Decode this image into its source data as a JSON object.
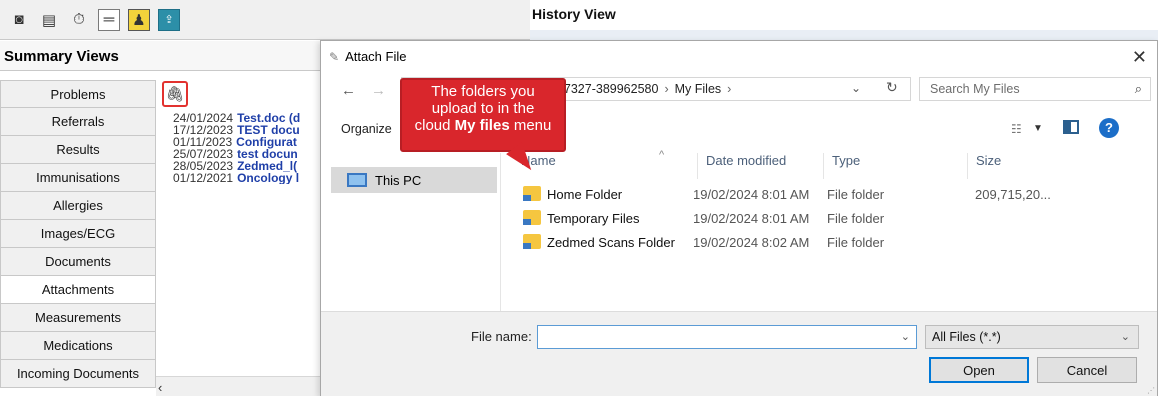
{
  "app": {
    "toolbar_icons": [
      "camera-icon",
      "clipboard-icon",
      "timer-icon",
      "ruler-icon",
      "person-icon",
      "upload-icon"
    ],
    "summary_title": "Summary Views",
    "history_title": "History View",
    "sidebar": {
      "items": [
        {
          "label": "Problems"
        },
        {
          "label": "Referrals"
        },
        {
          "label": "Results"
        },
        {
          "label": "Immunisations"
        },
        {
          "label": "Allergies"
        },
        {
          "label": "Images/ECG"
        },
        {
          "label": "Documents"
        },
        {
          "label": "Attachments"
        },
        {
          "label": "Measurements"
        },
        {
          "label": "Medications"
        },
        {
          "label": "Incoming Documents"
        }
      ]
    },
    "records": [
      {
        "date": "24/01/2024",
        "name": "Test.doc (d"
      },
      {
        "date": "17/12/2023",
        "name": "TEST docu"
      },
      {
        "date": "01/11/2023",
        "name": "Configurat"
      },
      {
        "date": "25/07/2023",
        "name": "test docun"
      },
      {
        "date": "28/05/2023",
        "name": "Zedmed_l("
      },
      {
        "date": "01/12/2021",
        "name": "Oncology l"
      }
    ]
  },
  "dialog": {
    "title": "Attach File",
    "address": {
      "segment1": "347327-389962580",
      "segment2": "My Files"
    },
    "search_placeholder": "Search My Files",
    "organize": "Organize",
    "nav": {
      "this_pc": "This PC"
    },
    "columns": {
      "name": "Name",
      "date": "Date modified",
      "type": "Type",
      "size": "Size"
    },
    "files": [
      {
        "name": "Home Folder",
        "date": "19/02/2024 8:01 AM",
        "type": "File folder",
        "size": "209,715,20..."
      },
      {
        "name": "Temporary Files",
        "date": "19/02/2024 8:01 AM",
        "type": "File folder",
        "size": ""
      },
      {
        "name": "Zedmed Scans Folder",
        "date": "19/02/2024 8:02 AM",
        "type": "File folder",
        "size": ""
      }
    ],
    "file_name_label": "File name:",
    "file_name_value": "",
    "filter": "All Files (*.*)",
    "open_label": "Open",
    "cancel_label": "Cancel"
  },
  "callout": {
    "line1": "The folders you",
    "line2": "upload to in the",
    "line3_prefix": "cloud ",
    "line3_bold": "My files",
    "line3_suffix": " menu"
  },
  "colors": {
    "callout": "#d9262c",
    "link": "#1f3fa8",
    "accent": "#0078d7"
  }
}
